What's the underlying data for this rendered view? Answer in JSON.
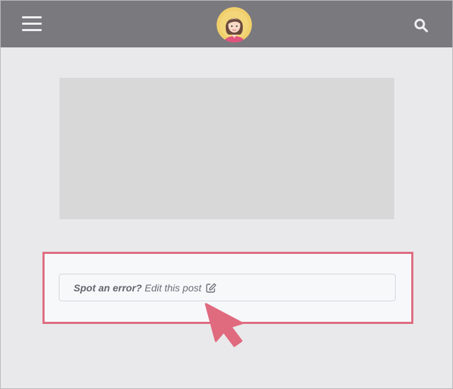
{
  "header": {
    "menu_icon": "hamburger-menu-icon",
    "avatar_icon": "avatar-woman-icon",
    "search_icon": "search-icon"
  },
  "main": {
    "edit_prompt": {
      "question": "Spot an error?",
      "link_label": "Edit this post",
      "icon": "edit-pencil-icon"
    }
  },
  "colors": {
    "header_bg": "#7a797e",
    "page_bg": "#e9e9eb",
    "highlight": "#de6c81",
    "placeholder": "#d8d8d9"
  }
}
